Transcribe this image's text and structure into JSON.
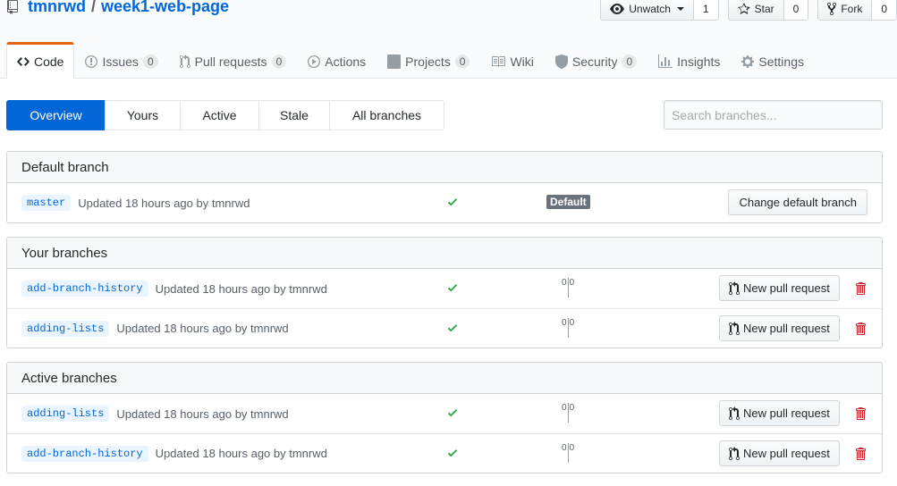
{
  "repo": {
    "owner": "tmnrwd",
    "separator": "/",
    "name": "week1-web-page"
  },
  "actions": {
    "unwatch": {
      "label": "Unwatch",
      "count": "1"
    },
    "star": {
      "label": "Star",
      "count": "0"
    },
    "fork": {
      "label": "Fork",
      "count": "0"
    }
  },
  "nav": {
    "code": "Code",
    "issues": {
      "label": "Issues",
      "count": "0"
    },
    "pulls": {
      "label": "Pull requests",
      "count": "0"
    },
    "actions": "Actions",
    "projects": {
      "label": "Projects",
      "count": "0"
    },
    "wiki": "Wiki",
    "security": {
      "label": "Security",
      "count": "0"
    },
    "insights": "Insights",
    "settings": "Settings"
  },
  "subnav": {
    "overview": "Overview",
    "yours": "Yours",
    "active": "Active",
    "stale": "Stale",
    "all": "All branches"
  },
  "search": {
    "placeholder": "Search branches..."
  },
  "colors": {
    "accent": "#0366d6",
    "success": "#28a745",
    "danger": "#cb2431",
    "tab_highlight": "#e36209"
  },
  "default_branch": {
    "title": "Default branch",
    "branch": {
      "name": "master",
      "updated": "Updated 18 hours ago by tmnrwd"
    },
    "badge": "Default",
    "change_button": "Change default branch"
  },
  "your_branches": {
    "title": "Your branches",
    "rows": [
      {
        "name": "add-branch-history",
        "updated": "Updated 18 hours ago by tmnrwd",
        "behind": "0",
        "ahead": "0",
        "pr_button": "New pull request"
      },
      {
        "name": "adding-lists",
        "updated": "Updated 18 hours ago by tmnrwd",
        "behind": "0",
        "ahead": "0",
        "pr_button": "New pull request"
      }
    ]
  },
  "active_branches": {
    "title": "Active branches",
    "rows": [
      {
        "name": "adding-lists",
        "updated": "Updated 18 hours ago by tmnrwd",
        "behind": "0",
        "ahead": "0",
        "pr_button": "New pull request"
      },
      {
        "name": "add-branch-history",
        "updated": "Updated 18 hours ago by tmnrwd",
        "behind": "0",
        "ahead": "0",
        "pr_button": "New pull request"
      }
    ]
  }
}
